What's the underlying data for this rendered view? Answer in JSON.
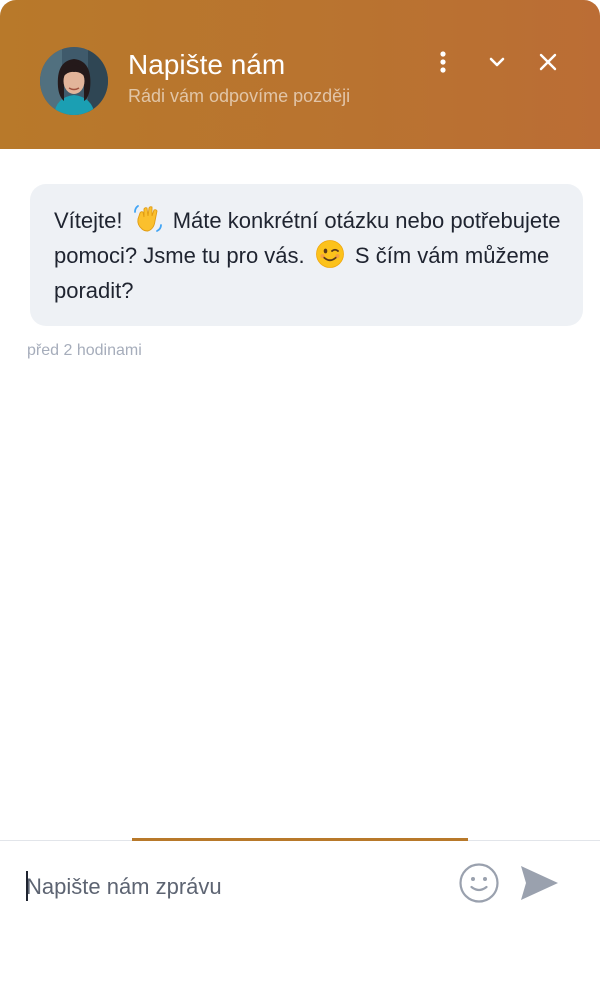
{
  "header": {
    "title": "Napište nám",
    "subtitle": "Rádi vám odpovíme později",
    "avatar": "agent-avatar",
    "menu_icon": "vertical-dots-icon",
    "minimize_icon": "chevron-down-icon",
    "close_icon": "close-icon",
    "gradient_start": "#b8792a",
    "gradient_end": "#bb6d35"
  },
  "conversation": {
    "message": {
      "part1": "Vítejte!",
      "emoji1": "waving-hand-emoji",
      "part2": "Máte konkrétní otázku nebo potřebujete pomoci? Jsme tu pro vás.",
      "emoji2": "winking-face-emoji",
      "part3": "S čím vám můžeme poradit?",
      "bubble_color": "#eef1f5"
    },
    "timestamp": "před 2 hodinami"
  },
  "composer": {
    "placeholder": "Napište nám zprávu",
    "emoji_icon": "smiley-icon",
    "send_icon": "send-icon",
    "accent_color": "#b8792a"
  }
}
